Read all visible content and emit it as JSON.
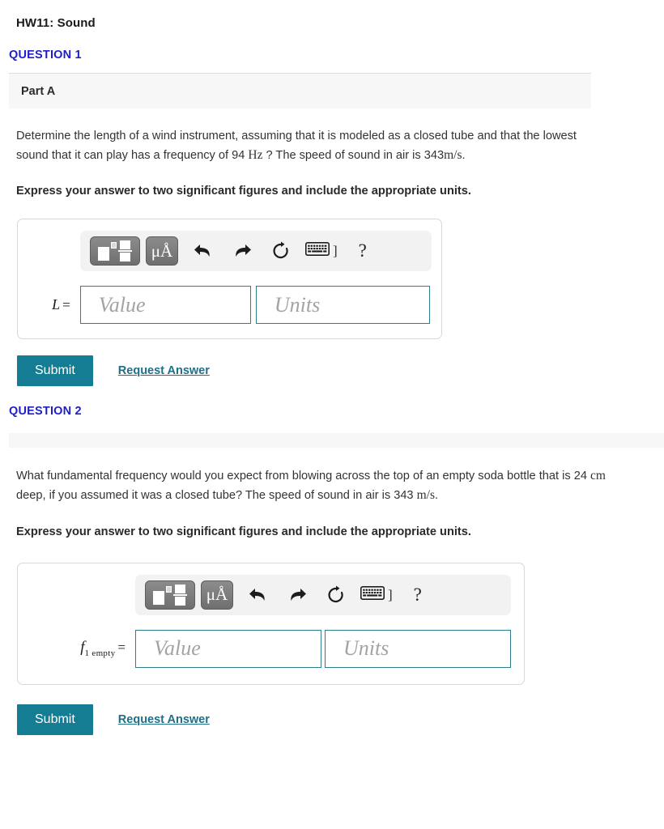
{
  "header": {
    "hw_title": "HW11: Sound"
  },
  "questions": [
    {
      "label": "QUESTION 1",
      "part_label": "Part A",
      "has_part_label": true,
      "body_segments": {
        "pre": "Determine the length of a wind instrument, assuming that it is modeled as a closed tube and that the lowest sound that it can play has a frequency of 94 ",
        "unit1": "Hz",
        "mid": " ? The speed of sound in air is 343",
        "unit2": "m/s",
        "post": "."
      },
      "instruction": "Express your answer to two significant figures and include the appropriate units.",
      "toolbar": {
        "template_icon": "math-template-icon",
        "unit_icon_label": "μÅ",
        "undo_icon": "undo-arrow-icon",
        "redo_icon": "redo-arrow-icon",
        "reset_icon": "reset-circular-arrow-icon",
        "keyboard_icon": "keyboard-icon",
        "bracket_label": "]",
        "help_label": "?"
      },
      "answer": {
        "variable": "L",
        "subscript": "",
        "equals": "=",
        "value_placeholder": "Value",
        "units_placeholder": "Units"
      },
      "submit_label": "Submit",
      "request_answer_label": "Request Answer"
    },
    {
      "label": "QUESTION 2",
      "part_label": "",
      "has_part_label": false,
      "body_segments": {
        "pre": "What fundamental frequency would you expect from blowing across the top of an empty soda bottle that is 24 ",
        "unit1": "cm",
        "mid": " deep, if you assumed it was a closed tube? The speed of sound in air is 343 ",
        "unit2": "m/s",
        "post": "."
      },
      "instruction": "Express your answer to two significant figures and include the appropriate units.",
      "toolbar": {
        "template_icon": "math-template-icon",
        "unit_icon_label": "μÅ",
        "undo_icon": "undo-arrow-icon",
        "redo_icon": "redo-arrow-icon",
        "reset_icon": "reset-circular-arrow-icon",
        "keyboard_icon": "keyboard-icon",
        "bracket_label": "]",
        "help_label": "?"
      },
      "answer": {
        "variable": "f",
        "subscript": "1 empty",
        "equals": "=",
        "value_placeholder": "Value",
        "units_placeholder": "Units"
      },
      "submit_label": "Submit",
      "request_answer_label": "Request Answer"
    }
  ],
  "colors": {
    "question_heading": "#1f1fc4",
    "submit_button": "#147d94",
    "link": "#1f6f86",
    "field_border": "#2d7f8e",
    "part_bar_bg": "#f7f7f7"
  }
}
